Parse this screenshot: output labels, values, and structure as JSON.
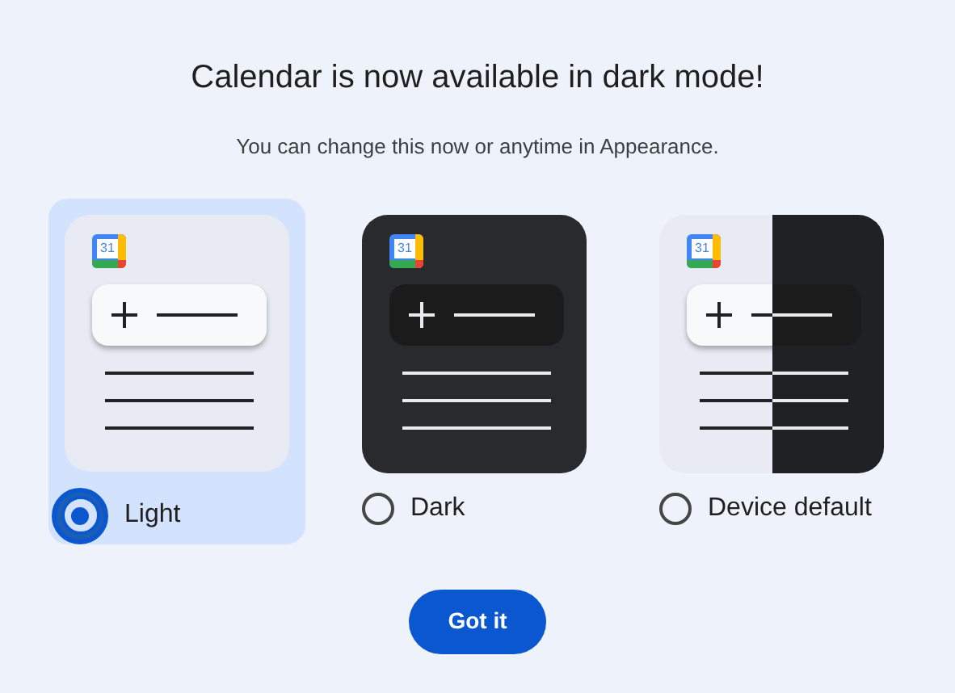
{
  "dialog": {
    "title": "Calendar is now available in dark mode!",
    "subtitle": "You can change this now or anytime in Appearance."
  },
  "options": [
    {
      "label": "Light",
      "kind": "light",
      "selected": true,
      "icon_text": "31"
    },
    {
      "label": "Dark",
      "kind": "dark",
      "selected": false,
      "icon_text": "31"
    },
    {
      "label": "Device default",
      "kind": "split",
      "selected": false,
      "icon_text": "31"
    }
  ],
  "button": "Got it"
}
